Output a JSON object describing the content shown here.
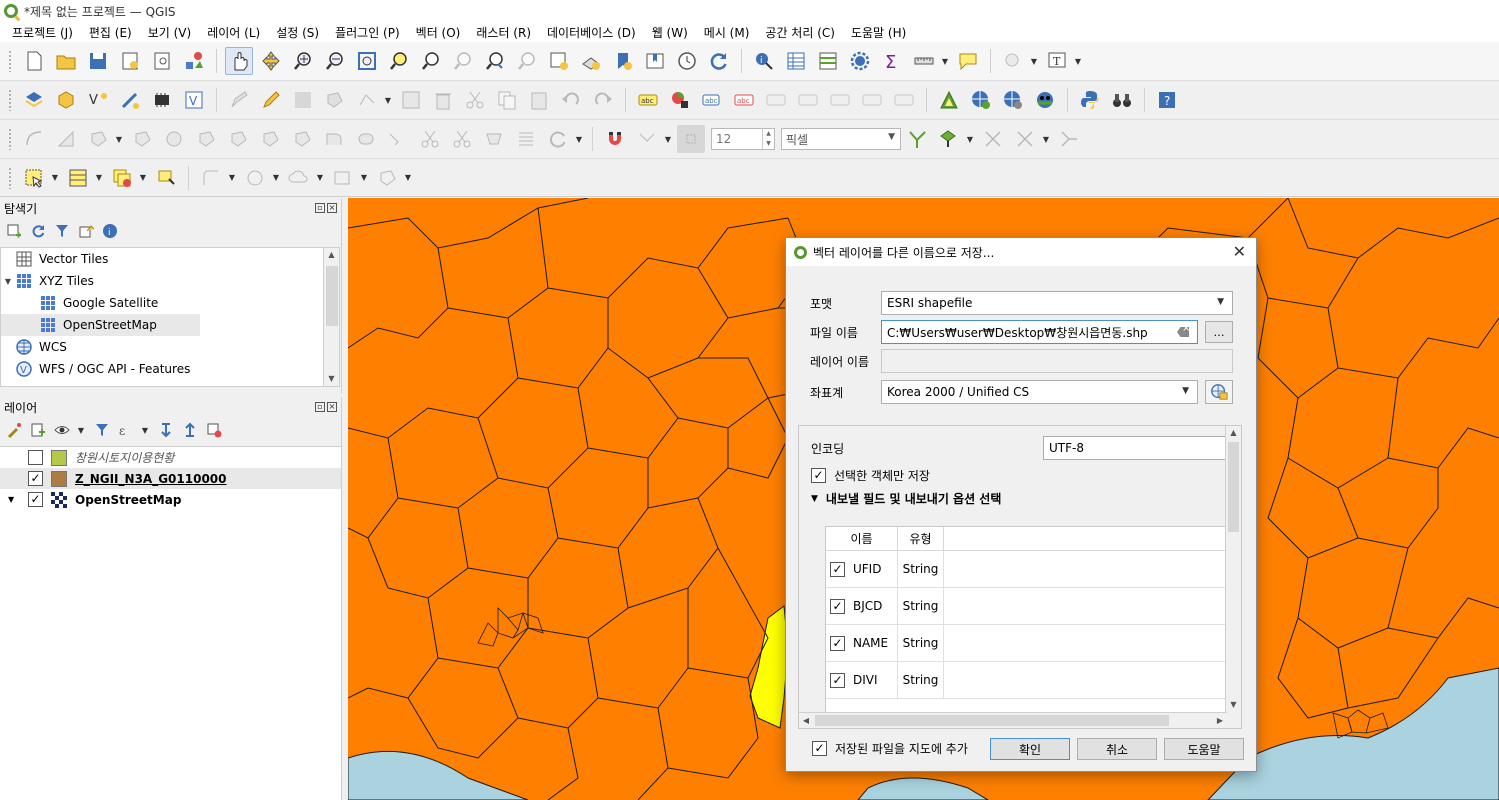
{
  "window": {
    "title": "*제목 없는 프로젝트 — QGIS"
  },
  "menubar": [
    "프로젝트 (J)",
    "편집 (E)",
    "보기 (V)",
    "레이어 (L)",
    "설정 (S)",
    "플러그인 (P)",
    "벡터 (O)",
    "래스터 (R)",
    "데이터베이스 (D)",
    "웹 (W)",
    "메시 (M)",
    "공간 처리 (C)",
    "도움말 (H)"
  ],
  "snapping": {
    "tolerance": "12",
    "unit": "픽셀"
  },
  "browser_panel": {
    "title": "탐색기",
    "items": [
      {
        "label": "Vector Tiles",
        "indent": 0,
        "expander": ""
      },
      {
        "label": "XYZ Tiles",
        "indent": 0,
        "expander": "▼"
      },
      {
        "label": "Google Satellite",
        "indent": 1,
        "expander": ""
      },
      {
        "label": "OpenStreetMap",
        "indent": 1,
        "expander": ""
      },
      {
        "label": "WCS",
        "indent": 0,
        "expander": ""
      },
      {
        "label": "WFS / OGC API - Features",
        "indent": 0,
        "expander": ""
      }
    ]
  },
  "layers_panel": {
    "title": "레이어",
    "layers": [
      {
        "name": "창원시토지이용현황",
        "checked": false,
        "color": "#b5c84a"
      },
      {
        "name": "Z_NGII_N3A_G0110000",
        "checked": true,
        "color": "#b07a45"
      },
      {
        "name": "OpenStreetMap",
        "checked": true,
        "color": ""
      }
    ]
  },
  "dialog": {
    "title": "벡터 레이어를 다른 이름으로 저장...",
    "format_label": "포맷",
    "format_value": "ESRI shapefile",
    "filename_label": "파일 이름",
    "filename_value": "C:₩Users₩user₩Desktop₩창원시읍면동.shp",
    "browse_label": "…",
    "layername_label": "레이어 이름",
    "layername_value": "",
    "crs_label": "좌표계",
    "crs_value": "Korea 2000 / Unified CS",
    "encoding_label": "인코딩",
    "encoding_value": "UTF-8",
    "selected_only_label": "선택한 객체만 저장",
    "fields_group_label": "내보낼 필드 및 내보내기 옵션 선택",
    "table_headers": [
      "이름",
      "유형"
    ],
    "fields": [
      {
        "name": "UFID",
        "type": "String",
        "checked": true
      },
      {
        "name": "BJCD",
        "type": "String",
        "checked": true
      },
      {
        "name": "NAME",
        "type": "String",
        "checked": true
      },
      {
        "name": "DIVI",
        "type": "String",
        "checked": true
      }
    ],
    "add_to_map_label": "저장된 파일을 지도에 추가",
    "ok_label": "확인",
    "cancel_label": "취소",
    "help_label": "도움말"
  },
  "colors": {
    "map_fill": "#ff8000",
    "selection": "#ffff00",
    "sea": "#aad3df",
    "qgis_green": "#589632"
  }
}
